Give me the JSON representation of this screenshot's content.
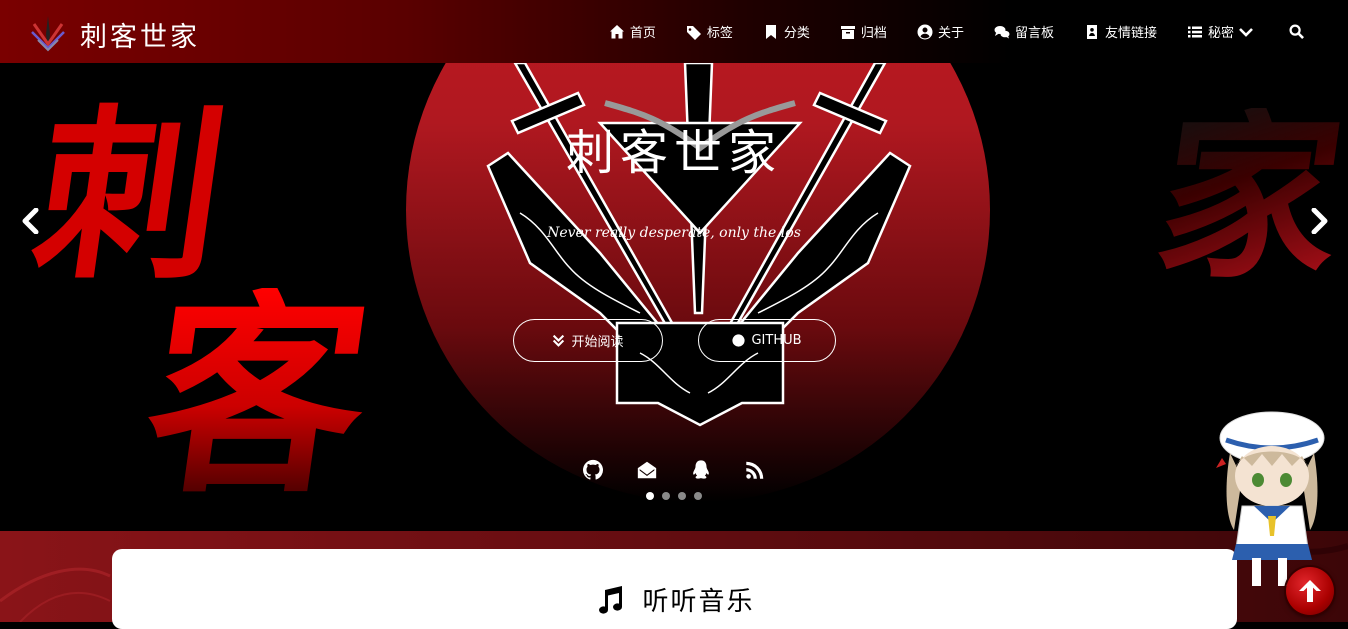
{
  "navbar": {
    "brand": "刺客世家",
    "items": [
      {
        "label": "首页",
        "icon": "home-icon"
      },
      {
        "label": "标签",
        "icon": "tags-icon"
      },
      {
        "label": "分类",
        "icon": "bookmark-icon"
      },
      {
        "label": "归档",
        "icon": "archive-icon"
      },
      {
        "label": "关于",
        "icon": "user-circle-icon"
      },
      {
        "label": "留言板",
        "icon": "comments-icon"
      },
      {
        "label": "友情链接",
        "icon": "address-card-icon"
      },
      {
        "label": "秘密",
        "icon": "list-icon"
      }
    ],
    "search_icon": "search-icon"
  },
  "hero": {
    "title": "刺客世家",
    "subtitle": "Never really desperate, only the los",
    "calligraphy": [
      "刺",
      "客",
      "家"
    ],
    "read_button": "开始阅读",
    "github_button": "GITHUB",
    "social_icons": [
      "github-icon",
      "envelope-icon",
      "qq-icon",
      "rss-icon"
    ],
    "slides": 4,
    "active_slide": 1
  },
  "music": {
    "title": "听听音乐",
    "icon": "music-icon"
  },
  "colors": {
    "accent": "#c41a22",
    "nav_start": "#7a0000",
    "background": "#000000",
    "card": "#ffffff"
  }
}
